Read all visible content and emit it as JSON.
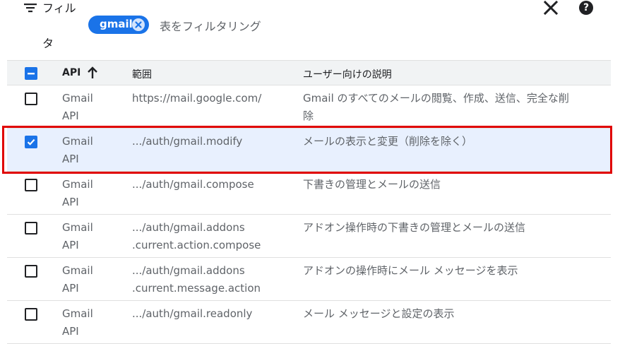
{
  "filter": {
    "label_line1": "フィル",
    "label_line2": "タ",
    "chip": "gmail",
    "placeholder": "表をフィルタリング"
  },
  "icons": {
    "filter": "filter-icon",
    "close": "close-icon",
    "help": "help-icon",
    "sort": "arrow-up-icon",
    "chip_remove": "cancel-icon"
  },
  "colors": {
    "accent": "#1a73e8",
    "selected_row": "#e8f0fe",
    "highlight": "#e00000",
    "header_bg": "#f1f3f4"
  },
  "table": {
    "header": {
      "api": "API",
      "scope": "範囲",
      "description": "ユーザー向けの説明",
      "select_all_state": "indeterminate"
    },
    "rows": [
      {
        "checked": false,
        "api_line1": "Gmail",
        "api_line2": "API",
        "scope_line1": "https://mail.google.com/",
        "scope_line2": "",
        "desc_line1": "Gmail のすべてのメールの閲覧、作成、送信、完全な削",
        "desc_line2": "除"
      },
      {
        "checked": true,
        "api_line1": "Gmail",
        "api_line2": "API",
        "scope_line1": ".../auth/gmail.modify",
        "scope_line2": "",
        "desc_line1": "メールの表示と変更（削除を除く）",
        "desc_line2": ""
      },
      {
        "checked": false,
        "api_line1": "Gmail",
        "api_line2": "API",
        "scope_line1": ".../auth/gmail.compose",
        "scope_line2": "",
        "desc_line1": "下書きの管理とメールの送信",
        "desc_line2": ""
      },
      {
        "checked": false,
        "api_line1": "Gmail",
        "api_line2": "API",
        "scope_line1": ".../auth/gmail.addons",
        "scope_line2": ".current.action.compose",
        "desc_line1": "アドオン操作時の下書きの管理とメールの送信",
        "desc_line2": ""
      },
      {
        "checked": false,
        "api_line1": "Gmail",
        "api_line2": "API",
        "scope_line1": ".../auth/gmail.addons",
        "scope_line2": ".current.message.action",
        "desc_line1": "アドオンの操作時にメール メッセージを表示",
        "desc_line2": ""
      },
      {
        "checked": false,
        "api_line1": "Gmail",
        "api_line2": "API",
        "scope_line1": ".../auth/gmail.readonly",
        "scope_line2": "",
        "desc_line1": "メール メッセージと設定の表示",
        "desc_line2": ""
      }
    ]
  }
}
